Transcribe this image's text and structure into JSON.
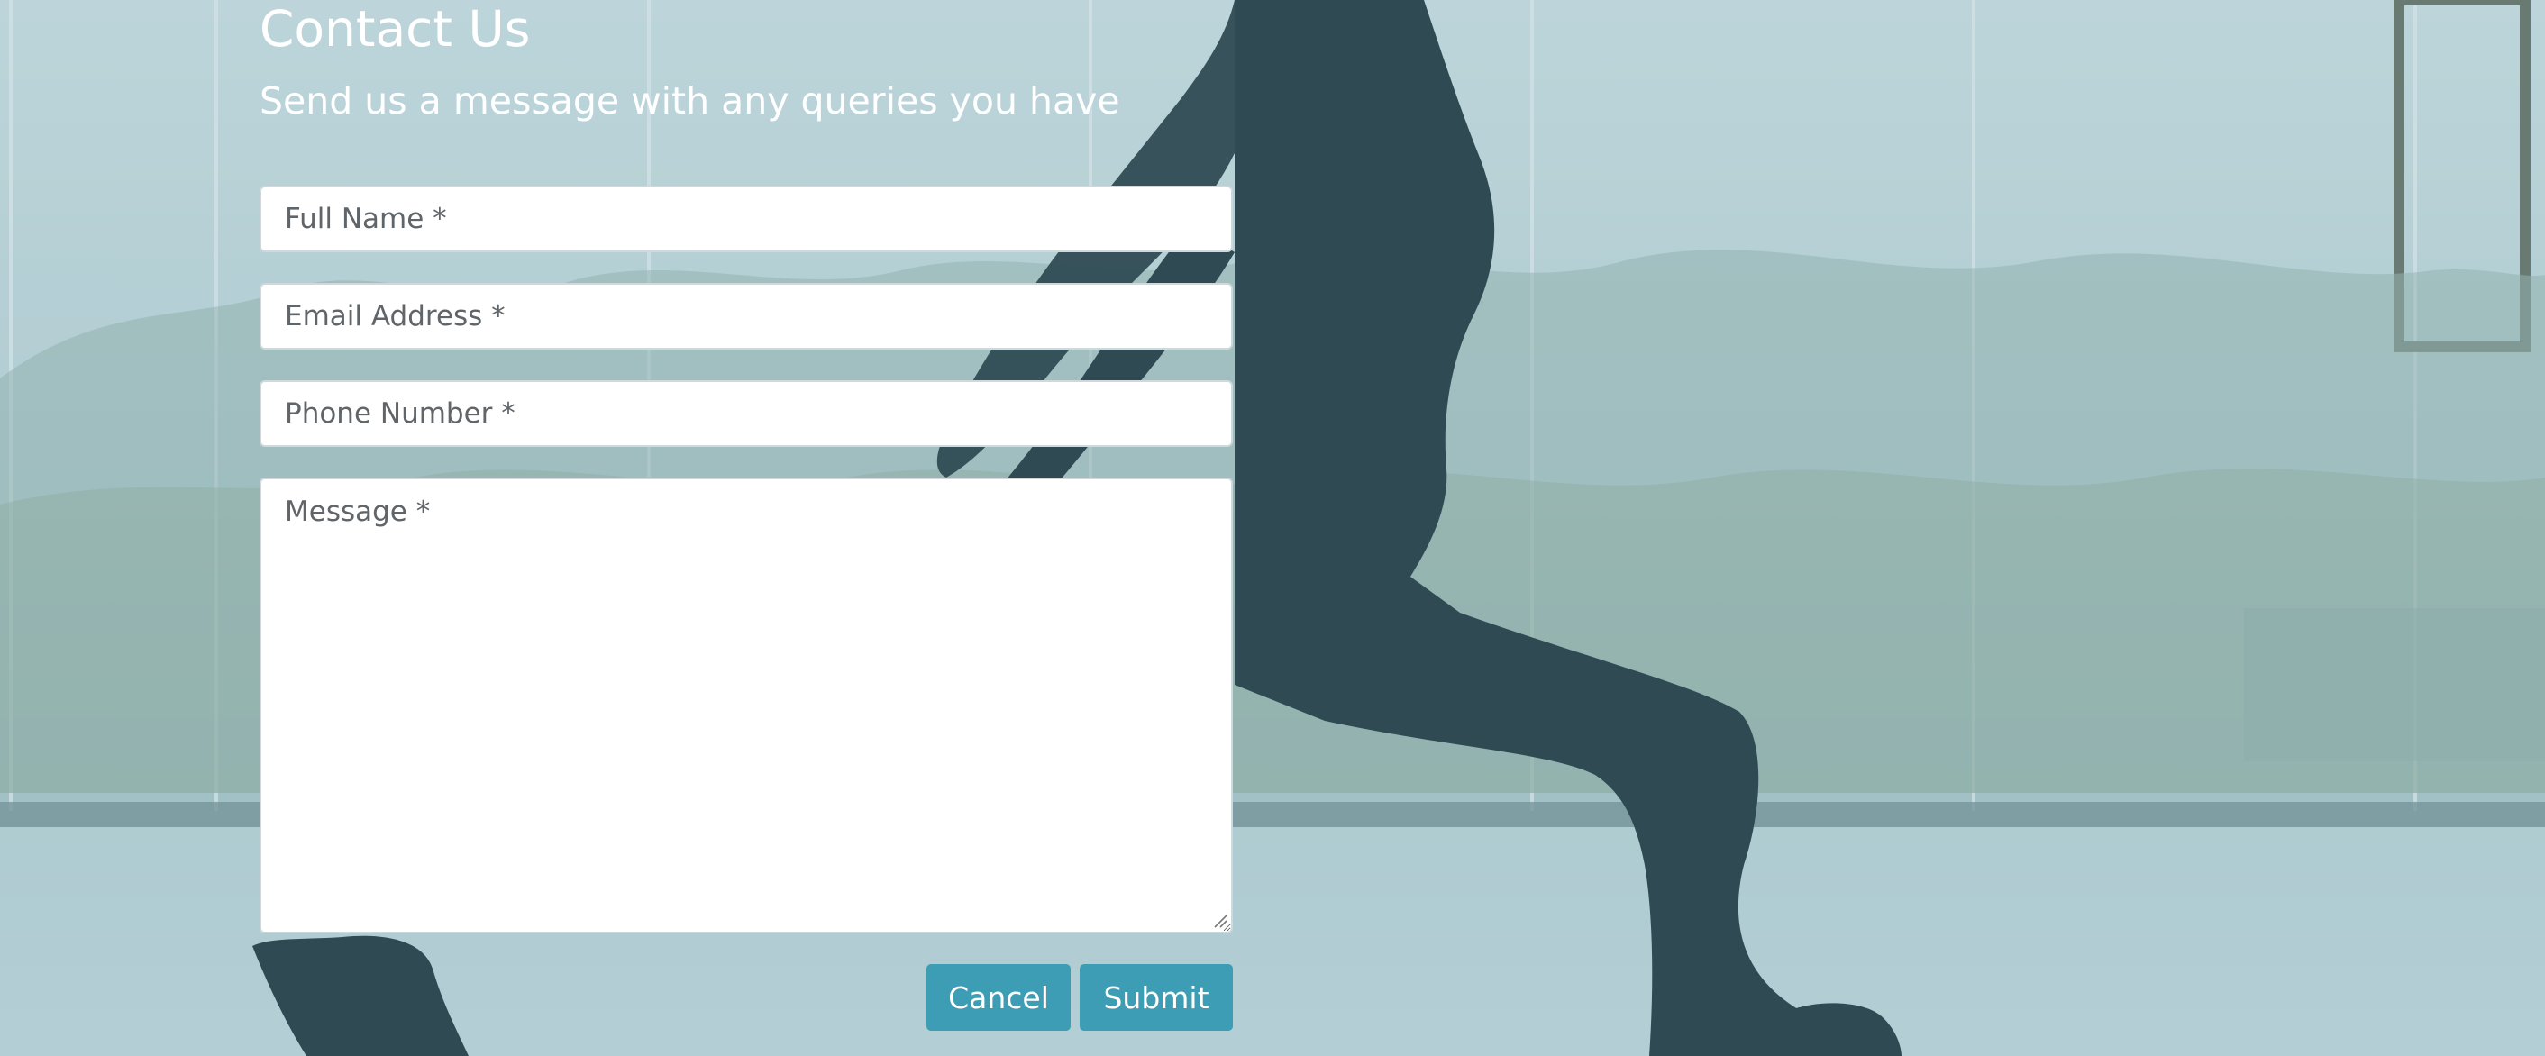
{
  "contact": {
    "title": "Contact Us",
    "subtitle": "Send us a message with any queries you have"
  },
  "form": {
    "full_name_placeholder": "Full Name *",
    "email_placeholder": "Email Address *",
    "phone_placeholder": "Phone Number *",
    "message_placeholder": "Message *",
    "full_name_value": "",
    "email_value": "",
    "phone_value": "",
    "message_value": ""
  },
  "buttons": {
    "cancel_label": "Cancel",
    "submit_label": "Submit"
  },
  "colors": {
    "overlay": "#a9c7cc",
    "button": "#3d9db4",
    "silhouette": "#1f3a43",
    "text": "#ffffff"
  }
}
